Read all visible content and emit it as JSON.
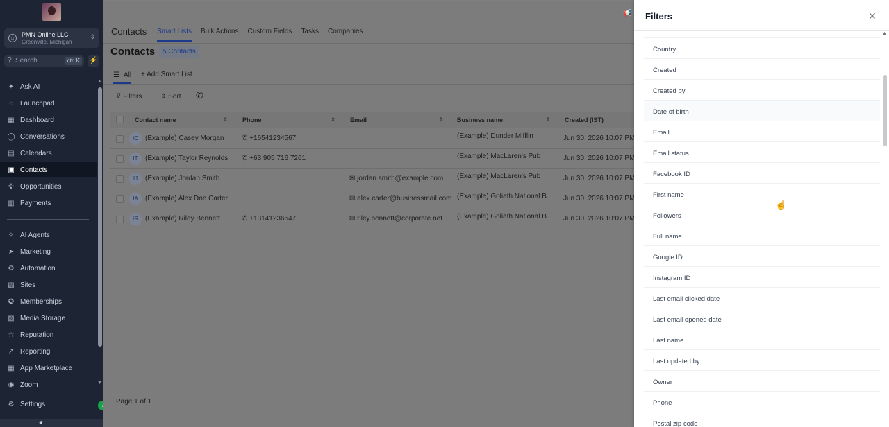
{
  "sidebar": {
    "location_name": "PMN Online LLC",
    "location_city": "Greenville, Michigan",
    "search_placeholder": "Search",
    "search_shortcut": "ctrl K",
    "nav": [
      {
        "label": "Ask AI",
        "icon": "sparkle-icon",
        "glyph": "✦"
      },
      {
        "label": "Launchpad",
        "icon": "launchpad-icon",
        "glyph": "◌"
      },
      {
        "label": "Dashboard",
        "icon": "dashboard-icon",
        "glyph": "▦"
      },
      {
        "label": "Conversations",
        "icon": "chat-icon",
        "glyph": "◯"
      },
      {
        "label": "Calendars",
        "icon": "calendar-icon",
        "glyph": "▤"
      },
      {
        "label": "Contacts",
        "icon": "contacts-icon",
        "glyph": "▣"
      },
      {
        "label": "Opportunities",
        "icon": "opportunities-icon",
        "glyph": "✣"
      },
      {
        "label": "Payments",
        "icon": "payments-icon",
        "glyph": "▥"
      },
      {
        "label": "AI Agents",
        "icon": "ai-agents-icon",
        "glyph": "✧"
      },
      {
        "label": "Marketing",
        "icon": "marketing-icon",
        "glyph": "➤"
      },
      {
        "label": "Automation",
        "icon": "automation-icon",
        "glyph": "⚙"
      },
      {
        "label": "Sites",
        "icon": "sites-icon",
        "glyph": "▧"
      },
      {
        "label": "Memberships",
        "icon": "memberships-icon",
        "glyph": "✪"
      },
      {
        "label": "Media Storage",
        "icon": "media-icon",
        "glyph": "▨"
      },
      {
        "label": "Reputation",
        "icon": "star-icon",
        "glyph": "☆"
      },
      {
        "label": "Reporting",
        "icon": "reporting-icon",
        "glyph": "↗"
      },
      {
        "label": "App Marketplace",
        "icon": "marketplace-icon",
        "glyph": "▦"
      },
      {
        "label": "Zoom",
        "icon": "zoom-icon",
        "glyph": "◉"
      },
      {
        "label": "Settings",
        "icon": "gear-icon",
        "glyph": "⚙"
      }
    ],
    "active": "Contacts"
  },
  "topbar": {
    "section": "Contacts",
    "tabs": [
      "Smart Lists",
      "Bulk Actions",
      "Custom Fields",
      "Tasks",
      "Companies"
    ],
    "active_tab": "Smart Lists"
  },
  "contacts": {
    "title": "Contacts",
    "count": "5 Contacts",
    "view_all": "All",
    "add_smart_list": "Add Smart List",
    "filters_label": "Filters",
    "sort_label": "Sort",
    "columns": [
      "Contact name",
      "Phone",
      "Email",
      "Business name",
      "Created (IST)"
    ],
    "rows": [
      {
        "initials": "IC",
        "name": "(Example) Casey Morgan",
        "phone": "+16541234567",
        "email": "",
        "business": "(Example) Dunder Mifflin",
        "created": "Jun 30, 2026 10:07 PM"
      },
      {
        "initials": "IT",
        "name": "(Example) Taylor Reynolds",
        "phone": "+63 905 716 7261",
        "email": "",
        "business": "(Example) MacLaren's Pub",
        "created": "Jun 30, 2026 10:07 PM"
      },
      {
        "initials": "IJ",
        "name": "(Example) Jordan Smith",
        "phone": "",
        "email": "jordan.smith@example.com",
        "business": "(Example) MacLaren's Pub",
        "created": "Jun 30, 2026 10:07 PM"
      },
      {
        "initials": "IA",
        "name": "(Example) Alex Doe Carter",
        "phone": "",
        "email": "alex.carter@businessmail.com",
        "business": "(Example) Goliath National B...",
        "created": "Jun 30, 2026 10:07 PM"
      },
      {
        "initials": "IR",
        "name": "(Example) Riley Bennett",
        "phone": "+13141236547",
        "email": "riley.bennett@corporate.net",
        "business": "(Example) Goliath National B...",
        "created": "Jun 30, 2026 10:07 PM"
      }
    ],
    "pagination": "Page 1 of 1"
  },
  "filters_panel": {
    "title": "Filters",
    "fields": [
      "Country",
      "Created",
      "Created by",
      "Date of birth",
      "Email",
      "Email status",
      "Facebook ID",
      "First name",
      "Followers",
      "Full name",
      "Google ID",
      "Instagram ID",
      "Last email clicked date",
      "Last email opened date",
      "Last name",
      "Last updated by",
      "Owner",
      "Phone",
      "Postal zip code"
    ]
  }
}
